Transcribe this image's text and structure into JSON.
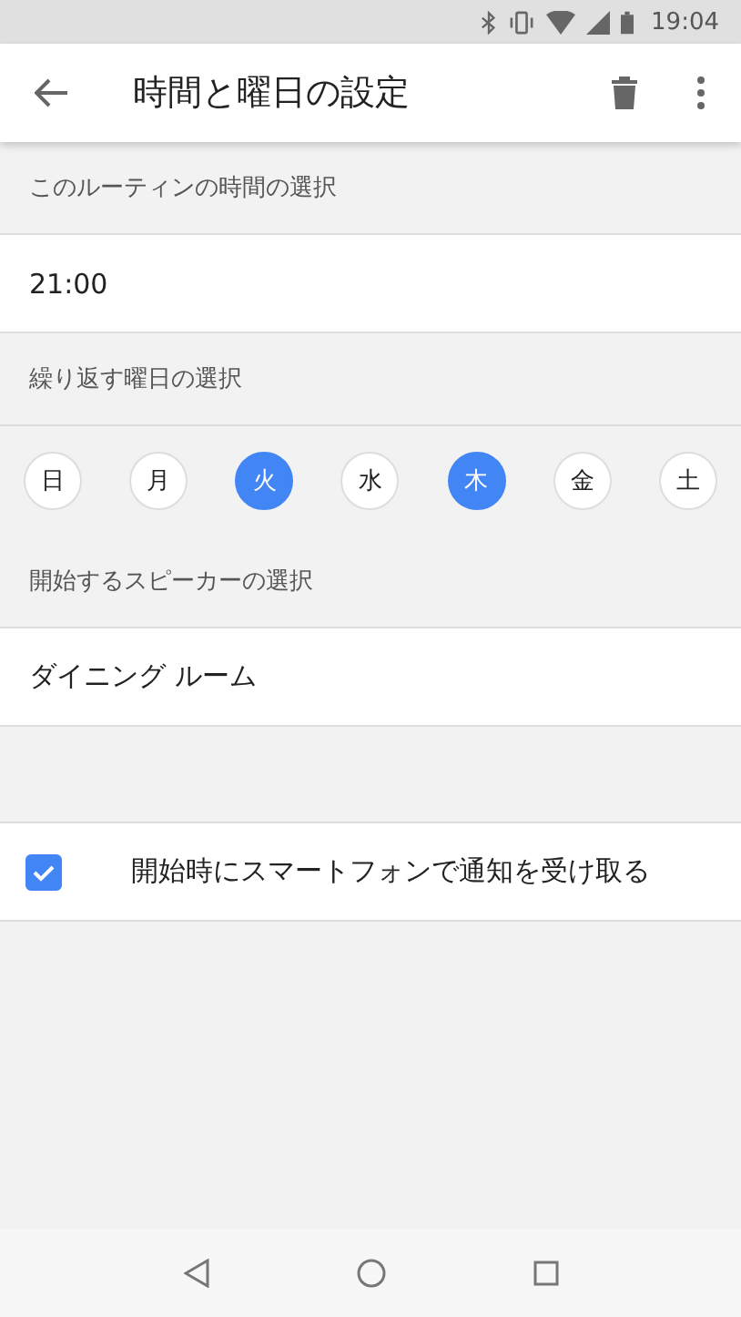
{
  "status_bar": {
    "time": "19:04"
  },
  "app_bar": {
    "title": "時間と曜日の設定"
  },
  "time_section": {
    "header": "このルーティンの時間の選択",
    "value": "21:00"
  },
  "days_section": {
    "header": "繰り返す曜日の選択",
    "days": [
      {
        "label": "日",
        "selected": false
      },
      {
        "label": "月",
        "selected": false
      },
      {
        "label": "火",
        "selected": true
      },
      {
        "label": "水",
        "selected": false
      },
      {
        "label": "木",
        "selected": true
      },
      {
        "label": "金",
        "selected": false
      },
      {
        "label": "土",
        "selected": false
      }
    ]
  },
  "speaker_section": {
    "header": "開始するスピーカーの選択",
    "value": "ダイニング ルーム"
  },
  "notify": {
    "label": "開始時にスマートフォンで通知を受け取る",
    "checked": true
  }
}
